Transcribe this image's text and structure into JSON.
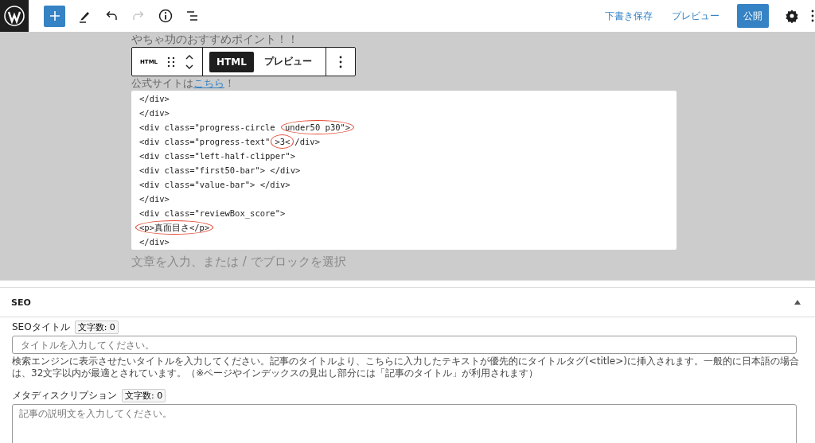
{
  "top_bar": {
    "save_draft": "下書き保存",
    "preview": "プレビュー",
    "publish": "公開"
  },
  "editor": {
    "heading": "やちゃ功のおすすめポイント！！",
    "link_line": {
      "before": "公式サイトは",
      "link": "こちら",
      "after": "！"
    },
    "block_toolbar": {
      "block_type": "HTML",
      "tabs": [
        {
          "label": "HTML",
          "selected": true
        },
        {
          "label": "プレビュー",
          "selected": false
        }
      ]
    },
    "code_lines": [
      {
        "parts": [
          {
            "text": "</div>",
            "circled": false
          }
        ]
      },
      {
        "parts": [
          {
            "text": "</div>",
            "circled": false
          }
        ]
      },
      {
        "parts": [
          {
            "text": "<div class=\"progress-circle ",
            "circled": false
          },
          {
            "text": "under50 p30\">",
            "circled": true
          }
        ]
      },
      {
        "parts": [
          {
            "text": "<div class=\"progress-text\"",
            "circled": false
          },
          {
            "text": ">3<",
            "circled": true
          },
          {
            "text": "/div>",
            "circled": false
          }
        ]
      },
      {
        "parts": [
          {
            "text": "<div class=\"left-half-clipper\">",
            "circled": false
          }
        ]
      },
      {
        "parts": [
          {
            "text": "<div class=\"first50-bar\"> </div>",
            "circled": false
          }
        ]
      },
      {
        "parts": [
          {
            "text": "<div class=\"value-bar\"> </div>",
            "circled": false
          }
        ]
      },
      {
        "parts": [
          {
            "text": "</div>",
            "circled": false
          }
        ]
      },
      {
        "parts": [
          {
            "text": "<div class=\"reviewBox_score\">",
            "circled": false
          }
        ]
      },
      {
        "parts": [
          {
            "text": "<p>真面目さ</p>",
            "circled": true
          }
        ]
      },
      {
        "parts": [
          {
            "text": "</div>",
            "circled": false
          }
        ]
      }
    ],
    "placeholder": "文章を入力、または / でブロックを選択"
  },
  "seo_panel": {
    "title": "SEO",
    "expanded": true,
    "fields": [
      {
        "kind": "input",
        "label": "SEOタイトル",
        "count": "文字数: 0",
        "placeholder": "タイトルを入力してください。",
        "help": "検索エンジンに表示させたいタイトルを入力してください。記事のタイトルより、こちらに入力したテキストが優先的にタイトルタグ(<title>)に挿入されます。一般的に日本語の場合は、32文字以内が最適とされています。（※ページやインデックスの見出し部分には「記事のタイトル」が利用されます）"
      },
      {
        "kind": "textarea",
        "label": "メタディスクリプション",
        "count": "文字数: 0",
        "placeholder": "記事の説明文を入力してください。"
      }
    ]
  }
}
